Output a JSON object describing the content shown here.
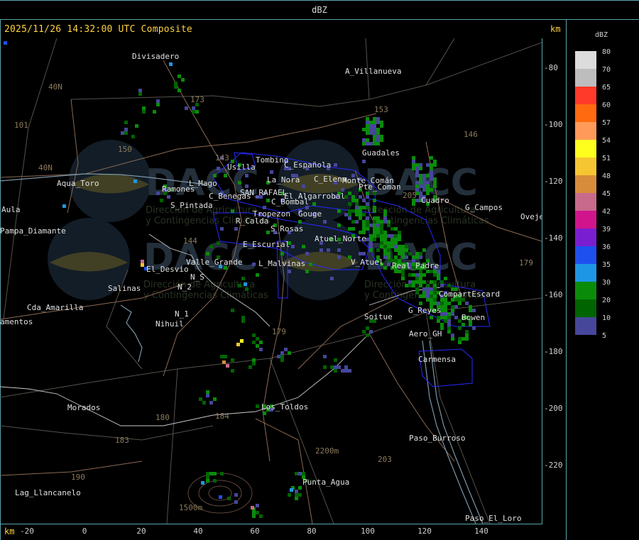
{
  "title": "dBZ",
  "header": "2025/11/26 14:32:00 UTC Composite",
  "unit_top": "km",
  "unit_bottom": "km",
  "y_ticks": [
    "-80",
    "-100",
    "-120",
    "-140",
    "-160",
    "-180",
    "-200",
    "-220"
  ],
  "x_ticks": [
    "-20",
    "0",
    "20",
    "40",
    "60",
    "80",
    "100",
    "120",
    "140"
  ],
  "legend": {
    "title": "dBZ",
    "levels": [
      {
        "label": "80",
        "color": "#dcdcdc"
      },
      {
        "label": "70",
        "color": "#bdbdbd"
      },
      {
        "label": "65",
        "color": "#ff3a2a"
      },
      {
        "label": "60",
        "color": "#ff6a10"
      },
      {
        "label": "57",
        "color": "#ff9a5a"
      },
      {
        "label": "54",
        "color": "#ffff1e"
      },
      {
        "label": "51",
        "color": "#f5c632"
      },
      {
        "label": "48",
        "color": "#d78c3c"
      },
      {
        "label": "45",
        "color": "#c86a8c"
      },
      {
        "label": "42",
        "color": "#d2148c"
      },
      {
        "label": "39",
        "color": "#7a1ed2"
      },
      {
        "label": "36",
        "color": "#1e50f0"
      },
      {
        "label": "35",
        "color": "#1e96e6"
      },
      {
        "label": "30",
        "color": "#0a8c0a"
      },
      {
        "label": "20",
        "color": "#006400"
      },
      {
        "label": "10",
        "color": "#46469b"
      },
      {
        "label": "5",
        "color": "#46469b"
      }
    ]
  },
  "places": [
    {
      "name": "Divisadero"
    },
    {
      "name": "A_Villanueva"
    },
    {
      "name": "Guadales"
    },
    {
      "name": "Tombino"
    },
    {
      "name": "C_Española"
    },
    {
      "name": "Usilla"
    },
    {
      "name": "La_Nora"
    },
    {
      "name": "C_Elena"
    },
    {
      "name": "El_Algarrobal"
    },
    {
      "name": "SAN_RAFAEL"
    },
    {
      "name": "C_Bombal"
    },
    {
      "name": "Pte_Coman"
    },
    {
      "name": "Aqua_Toro"
    },
    {
      "name": "Ramones"
    },
    {
      "name": "L_Mago"
    },
    {
      "name": "C_Benegas"
    },
    {
      "name": "S_Pintada"
    },
    {
      "name": "Cuadro"
    },
    {
      "name": "G_Campos"
    },
    {
      "name": "Ovejeria"
    },
    {
      "name": "Aula"
    },
    {
      "name": "Pampa_Diamante"
    },
    {
      "name": "Tropezon"
    },
    {
      "name": "Gouge"
    },
    {
      "name": "R_Calda"
    },
    {
      "name": "S_Rosas"
    },
    {
      "name": "Atuel_Norte"
    },
    {
      "name": "E_Escurial"
    },
    {
      "name": "Valle_Grande"
    },
    {
      "name": "L_Malvinas"
    },
    {
      "name": "V_Atuel"
    },
    {
      "name": "El_Desvio"
    },
    {
      "name": "Salinas"
    },
    {
      "name": "N_S"
    },
    {
      "name": "N_2"
    },
    {
      "name": "N_1"
    },
    {
      "name": "Nihuil"
    },
    {
      "name": "Cda_Amarilla"
    },
    {
      "name": "amentos"
    },
    {
      "name": "Soitue"
    },
    {
      "name": "G_Reyes"
    },
    {
      "name": "CompartEscard"
    },
    {
      "name": "Bowen"
    },
    {
      "name": "Aero_GH"
    },
    {
      "name": "Carmensa"
    },
    {
      "name": "Los_Toldos"
    },
    {
      "name": "Morados"
    },
    {
      "name": "Paso_Burroso"
    },
    {
      "name": "Punta_Agua"
    },
    {
      "name": "Lag_Llancanelo"
    },
    {
      "name": "Paso_El_Loro"
    },
    {
      "name": "Real_Padre"
    },
    {
      "name": "Monte_Comán"
    }
  ],
  "route_labels": [
    "40N",
    "40N",
    "101",
    "150",
    "153",
    "146",
    "143",
    "144",
    "173",
    "179",
    "180",
    "184",
    "183",
    "190",
    "203",
    "205",
    "179",
    "2200m",
    "1500m"
  ],
  "watermark": {
    "brand": "DACC",
    "line1": "Dirección de Agricultura",
    "line2": "y Contingencias Climáticas"
  },
  "colors": {
    "frame": "#5aa6ad",
    "header": "#ffd23f",
    "boundary": "#3232ff",
    "road": "#8a6a55",
    "route": "#b4b4b4"
  }
}
